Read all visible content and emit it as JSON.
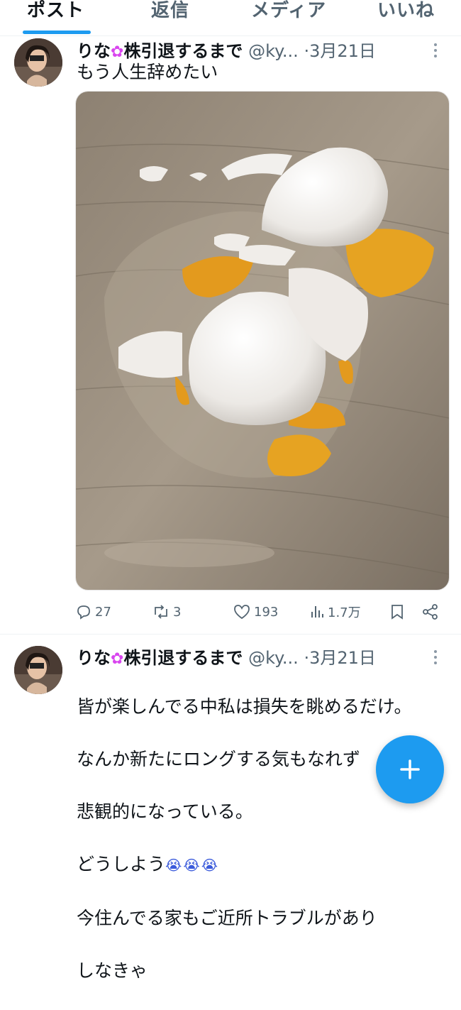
{
  "tabs": [
    {
      "label": "ポスト",
      "active": true
    },
    {
      "label": "返信",
      "active": false
    },
    {
      "label": "メディア",
      "active": false
    },
    {
      "label": "いいね",
      "active": false
    }
  ],
  "tweets": [
    {
      "name_prefix": "りな",
      "flower": "✿",
      "name_suffix": "株引退するまで",
      "handle": "@ky...",
      "dot": "·",
      "date": "3月21日",
      "text": "もう人生辞めたい",
      "media_alt": "broken-eggs-photo",
      "stats": {
        "replies": "27",
        "reposts": "3",
        "likes": "193",
        "views": "1.7万"
      }
    },
    {
      "name_prefix": "りな",
      "flower": "✿",
      "name_suffix": "株引退するまで",
      "handle": "@ky...",
      "dot": "·",
      "date": "3月21日",
      "lines": [
        "皆が楽しんでる中私は損失を眺めるだけ。",
        "なんか新たにロングする気もなれず",
        "悲観的になっている。",
        "どうしよう",
        "今住んでる家もご近所トラブルがあり",
        "しなきゃ"
      ],
      "emoji": "😭😭😭"
    }
  ],
  "fab": {
    "label": "+"
  },
  "colors": {
    "accent": "#1d9bf0",
    "muted": "#536471",
    "text": "#0f1419"
  }
}
